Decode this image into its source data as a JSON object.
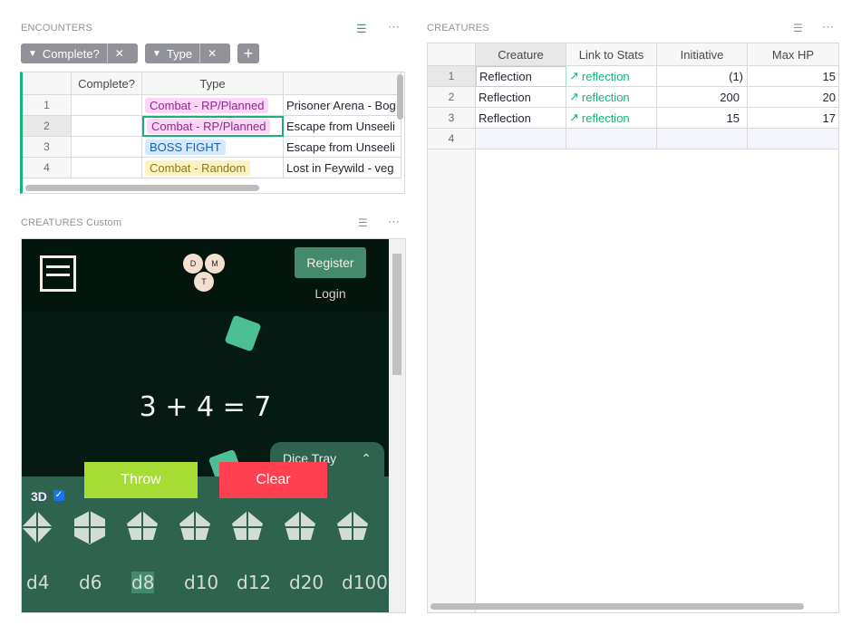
{
  "encounters": {
    "title": "ENCOUNTERS",
    "filters": [
      {
        "label": "Complete?"
      },
      {
        "label": "Type"
      }
    ],
    "columns": [
      "Complete?",
      "Type",
      ""
    ],
    "rows": [
      {
        "n": "1",
        "type": "Combat - RP/Planned",
        "name": "Prisoner Arena - Bog"
      },
      {
        "n": "2",
        "type": "Combat - RP/Planned",
        "name": "Escape from Unseeli"
      },
      {
        "n": "3",
        "type": "BOSS FIGHT",
        "name": "Escape from Unseeli"
      },
      {
        "n": "4",
        "type": "Combat - Random",
        "name": "Lost in Feywild - veg"
      }
    ]
  },
  "custom": {
    "title": "CREATURES Custom",
    "app": {
      "register": "Register",
      "login": "Login",
      "logo": [
        "D",
        "M",
        "T"
      ],
      "result": "3 + 4 = 7",
      "dice_tray": "Dice Tray",
      "throw": "Throw",
      "clear": "Clear",
      "toggle_3d": "3D",
      "checked": true,
      "dice": [
        "d4",
        "d6",
        "d8",
        "d10",
        "d12",
        "d20",
        "d100"
      ],
      "selected": "d8"
    }
  },
  "creatures": {
    "title": "CREATURES",
    "columns": [
      "Creature",
      "Link to Stats",
      "Initiative",
      "Max HP"
    ],
    "rows": [
      {
        "n": "1",
        "creature": "Reflection",
        "link": "reflection",
        "init": "(1)",
        "hp": "15"
      },
      {
        "n": "2",
        "creature": "Reflection",
        "link": "reflection",
        "init": "200",
        "hp": "20"
      },
      {
        "n": "3",
        "creature": "Reflection",
        "link": "reflection",
        "init": "15",
        "hp": "17"
      }
    ],
    "new_row": "4"
  },
  "colors": {
    "accent": "#16b378",
    "rp_tag_bg": "#fdd5f6",
    "rp_tag_fg": "#8c2a8c",
    "boss_bg": "#d6e8fc",
    "boss_fg": "#1f5fa8",
    "random_bg": "#fdf3c0",
    "random_fg": "#8a7b11",
    "throw": "#a6dd35",
    "clear": "#ff4050"
  }
}
